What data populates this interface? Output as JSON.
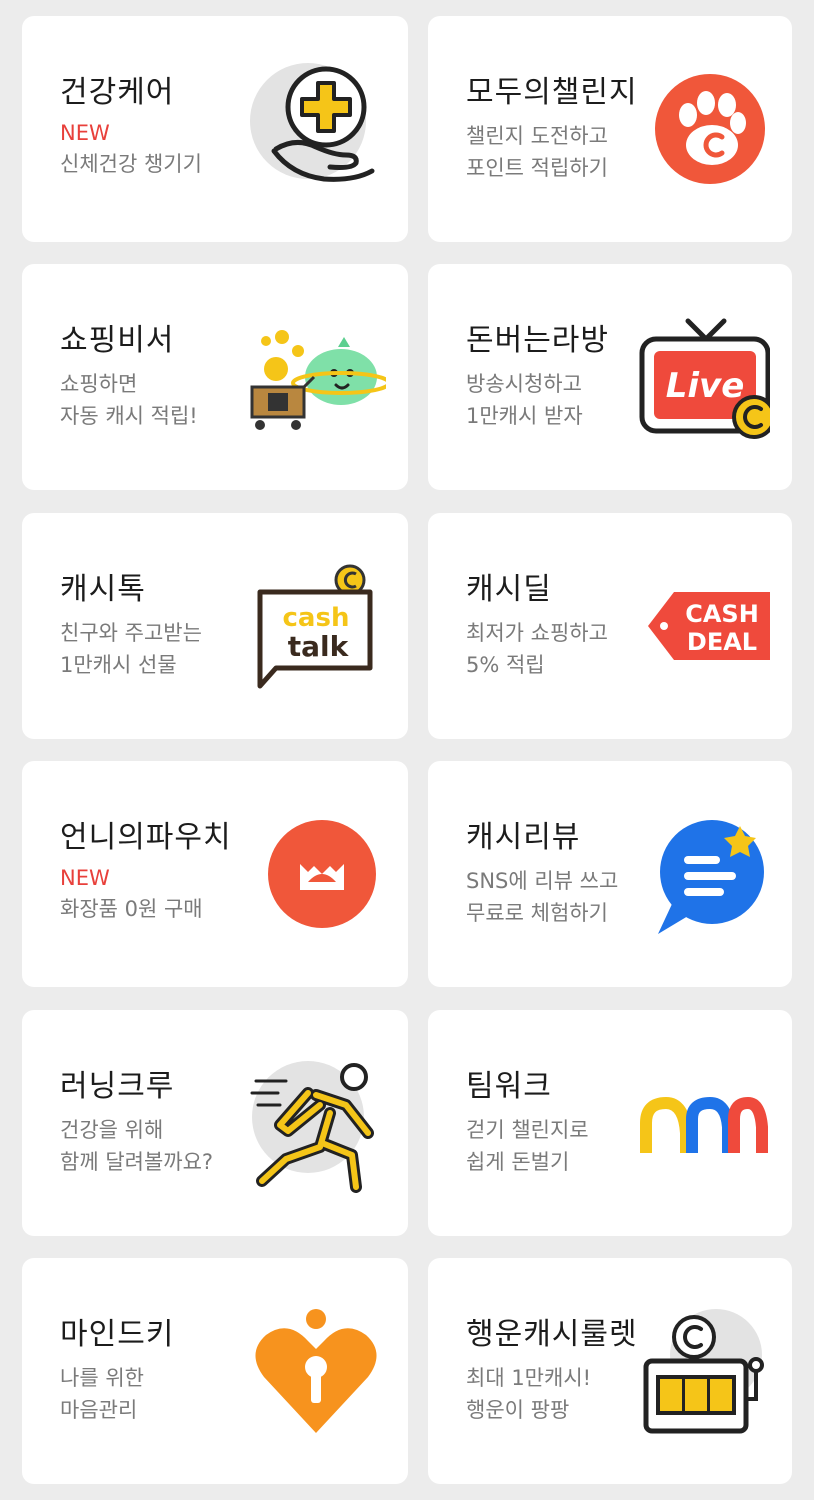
{
  "cards": [
    {
      "title": "건강케어",
      "badge": "NEW",
      "desc": [
        "신체건강 챙기기"
      ],
      "icon": "health-care-icon"
    },
    {
      "title": "모두의챌린지",
      "desc": [
        "챌린지 도전하고",
        "포인트 적립하기"
      ],
      "icon": "challenge-paw-icon"
    },
    {
      "title": "쇼핑비서",
      "desc": [
        "쇼핑하면",
        "자동 캐시 적립!"
      ],
      "icon": "shopping-assistant-icon"
    },
    {
      "title": "돈버는라방",
      "desc": [
        "방송시청하고",
        "1만캐시 받자"
      ],
      "icon": "live-tv-icon",
      "icon_text": "Live"
    },
    {
      "title": "캐시톡",
      "desc": [
        "친구와 주고받는",
        "1만캐시 선물"
      ],
      "icon": "cash-talk-icon",
      "icon_text": [
        "cash",
        "talk"
      ]
    },
    {
      "title": "캐시딜",
      "desc": [
        "최저가 쇼핑하고",
        "5% 적립"
      ],
      "icon": "cash-deal-tag-icon",
      "icon_text": [
        "CASH",
        "DEAL"
      ]
    },
    {
      "title": "언니의파우치",
      "badge": "NEW",
      "desc": [
        "화장품 0원 구매"
      ],
      "icon": "pouch-logo-icon"
    },
    {
      "title": "캐시리뷰",
      "desc": [
        "SNS에 리뷰 쓰고",
        "무료로 체험하기"
      ],
      "icon": "review-chat-icon"
    },
    {
      "title": "러닝크루",
      "desc": [
        "건강을 위해",
        "함께 달려볼까요?"
      ],
      "icon": "running-person-icon"
    },
    {
      "title": "팀워크",
      "desc": [
        "걷기 챌린지로",
        "쉽게 돈벌기"
      ],
      "icon": "teamwork-arches-icon"
    },
    {
      "title": "마인드키",
      "desc": [
        "나를 위한",
        "마음관리"
      ],
      "icon": "heart-keyhole-icon"
    },
    {
      "title": "행운캐시룰렛",
      "desc": [
        "최대 1만캐시!",
        "행운이 팡팡"
      ],
      "icon": "slot-machine-icon"
    }
  ],
  "colors": {
    "background": "#ececec",
    "card": "#ffffff",
    "new_badge": "#e8403b",
    "title": "#1c1c1c",
    "desc": "#7a7a7a",
    "yellow": "#f5c518",
    "orange_red": "#f0573a",
    "live_red": "#ef4a3c",
    "blue": "#1f73e8",
    "orange": "#f7931e"
  }
}
